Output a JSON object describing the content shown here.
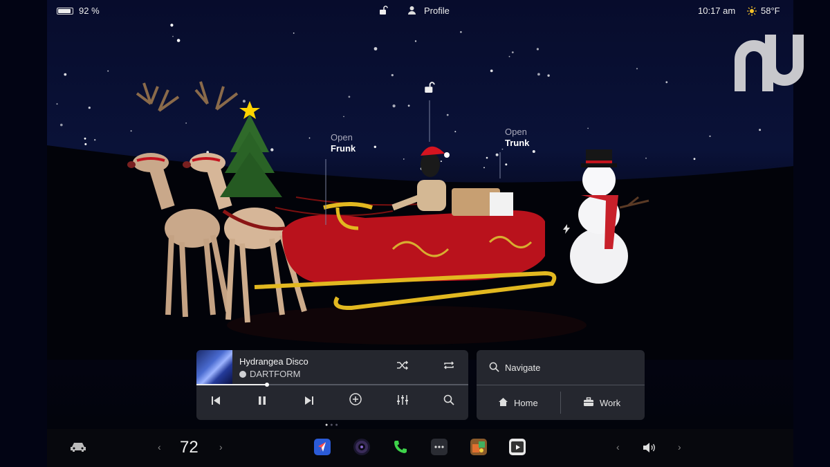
{
  "status": {
    "battery_percent": "92 %",
    "battery_level": 0.92,
    "profile_label": "Profile",
    "time": "10:17 am",
    "temperature": "58°F",
    "icons": [
      "lock-open-icon",
      "person-icon",
      "sun-icon"
    ]
  },
  "scene": {
    "frunk_label": {
      "line1": "Open",
      "line2": "Frunk"
    },
    "trunk_label": {
      "line1": "Open",
      "line2": "Trunk"
    },
    "icons": [
      "lock-open-icon",
      "charge-bolt-icon"
    ]
  },
  "media": {
    "song_title": "Hydrangea Disco",
    "artist": "DARTFORM",
    "progress": 0.26,
    "icons": [
      "shuffle-icon",
      "repeat-icon",
      "previous-icon",
      "pause-icon",
      "next-icon",
      "add-icon",
      "equalizer-icon",
      "search-icon"
    ]
  },
  "navigation": {
    "search_placeholder": "Navigate",
    "home_label": "Home",
    "work_label": "Work"
  },
  "dock": {
    "temperature": "72",
    "apps": [
      "car-icon",
      "navigation-app-icon",
      "camera-app-icon",
      "phone-app-icon",
      "more-apps-icon",
      "arcade-app-icon",
      "theater-app-icon",
      "volume-icon"
    ]
  },
  "colors": {
    "sky": "#0a1238",
    "panel": "#282a32",
    "phone_green": "#3ed34a",
    "star_gold": "#ffd400"
  }
}
